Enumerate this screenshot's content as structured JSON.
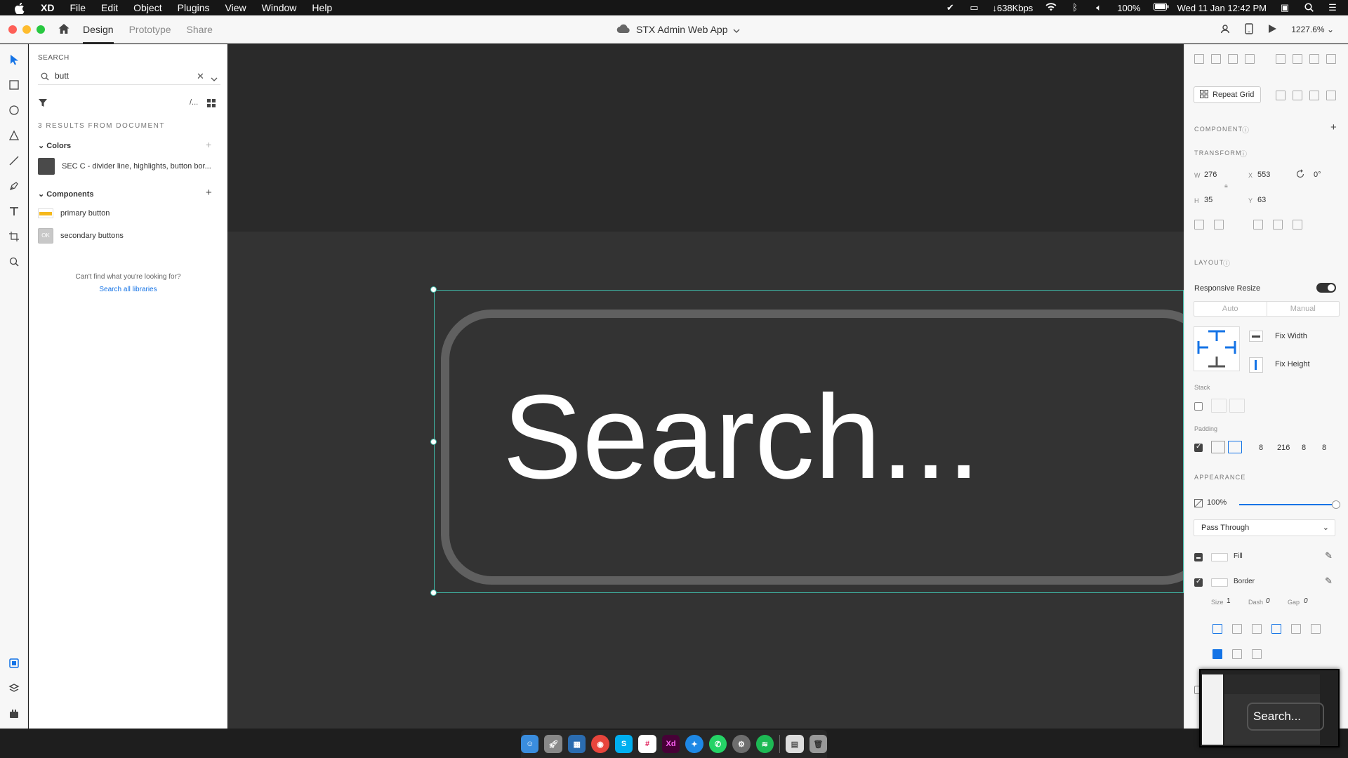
{
  "menubar": {
    "app_name": "XD",
    "menus": [
      "File",
      "Edit",
      "Object",
      "Plugins",
      "View",
      "Window",
      "Help"
    ],
    "network_speed": "↓638Kbps",
    "battery": "100%",
    "datetime": "Wed 11 Jan  12:42 PM"
  },
  "titlebar": {
    "tabs": [
      "Design",
      "Prototype",
      "Share"
    ],
    "active_tab": "Design",
    "document_title": "STX Admin Web App",
    "zoom": "1227.6%"
  },
  "assets": {
    "heading": "SEARCH",
    "search_value": "butt",
    "results_count": "3 RESULTS FROM DOCUMENT",
    "colors_title": "Colors",
    "color_items": [
      {
        "label": "SEC C - divider line, highlights, button bor...",
        "hex": "#4a4a4a"
      }
    ],
    "components_title": "Components",
    "component_items": [
      {
        "label": "primary button"
      },
      {
        "label": "secondary buttons",
        "thumb_text": "OK"
      }
    ],
    "cant_find": "Can't find what you're looking for?",
    "search_all": "Search all libraries",
    "more_label": "/..."
  },
  "canvas": {
    "button_text": "Search..."
  },
  "props": {
    "repeat_grid": "Repeat Grid",
    "component_title": "COMPONENT",
    "transform_title": "TRANSFORM",
    "w_label": "W",
    "w": "276",
    "x_label": "X",
    "x": "553",
    "rotation": "0°",
    "h_label": "H",
    "h": "35",
    "y_label": "Y",
    "y": "63",
    "layout_title": "LAYOUT",
    "responsive_resize": "Responsive Resize",
    "resize_modes": [
      "Auto",
      "Manual"
    ],
    "fix_width": "Fix Width",
    "fix_height": "Fix Height",
    "stack_label": "Stack",
    "padding_label": "Padding",
    "padding_values": [
      "8",
      "216",
      "8",
      "8"
    ],
    "appearance_title": "APPEARANCE",
    "opacity": "100%",
    "blend_mode": "Pass Through",
    "fill_label": "Fill",
    "border_label": "Border",
    "size_label": "Size",
    "size_value": "1",
    "dash_label": "Dash",
    "dash_value": "0",
    "gap_label": "Gap",
    "gap_value": "0"
  },
  "minimap": {
    "text": "Search..."
  },
  "dock": {
    "apps": [
      {
        "name": "finder",
        "color": "#3a8dde"
      },
      {
        "name": "launchpad",
        "color": "#888888"
      },
      {
        "name": "mission-control",
        "color": "#2b6cb0"
      },
      {
        "name": "chrome",
        "color": "#e8453c"
      },
      {
        "name": "skype",
        "color": "#00aff0"
      },
      {
        "name": "slack",
        "color": "#ffffff"
      },
      {
        "name": "xd",
        "color": "#470137"
      },
      {
        "name": "safari",
        "color": "#1e88e5"
      },
      {
        "name": "whatsapp",
        "color": "#25d366"
      },
      {
        "name": "settings",
        "color": "#6e6e6e"
      },
      {
        "name": "spotify",
        "color": "#1db954"
      }
    ],
    "xd_label": "Xd"
  },
  "colors": {
    "selection": "#3fb9a7",
    "accent": "#1473e6",
    "primary_button_yellow": "#f5b81b"
  }
}
